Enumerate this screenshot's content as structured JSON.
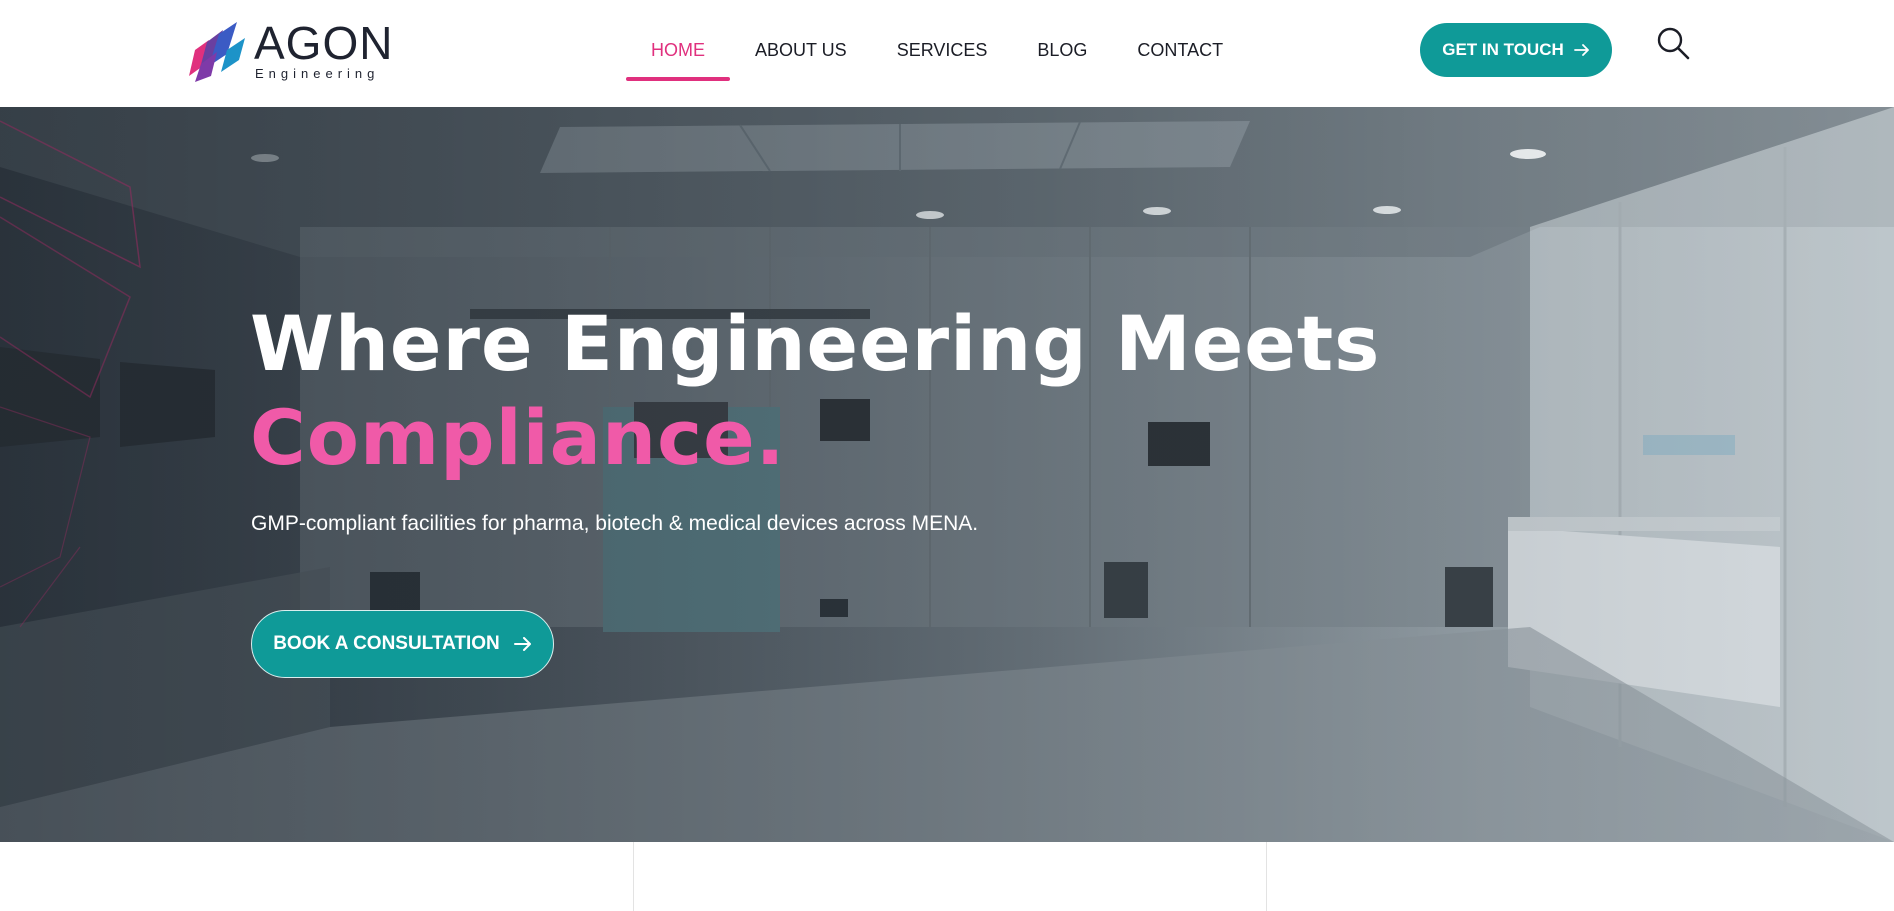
{
  "brand": {
    "name": "AGON",
    "tagline": "Engineering"
  },
  "nav": {
    "items": [
      {
        "label": "HOME",
        "active": true
      },
      {
        "label": "ABOUT US",
        "active": false
      },
      {
        "label": "SERVICES",
        "active": false
      },
      {
        "label": "BLOG",
        "active": false
      },
      {
        "label": "CONTACT",
        "active": false
      }
    ]
  },
  "header": {
    "cta_label": "GET IN TOUCH",
    "cta_icon": "arrow-right-icon",
    "search_icon": "search-icon"
  },
  "hero": {
    "title_line1": "Where Engineering Meets",
    "title_line2": "Compliance.",
    "subtitle": "GMP-compliant facilities for pharma, biotech & medical devices across MENA.",
    "cta_label": "BOOK A CONSULTATION"
  },
  "colors": {
    "accent_pink": "#e0307e",
    "accent_teal": "#0f9a98",
    "text_dark": "#1b1d26"
  }
}
